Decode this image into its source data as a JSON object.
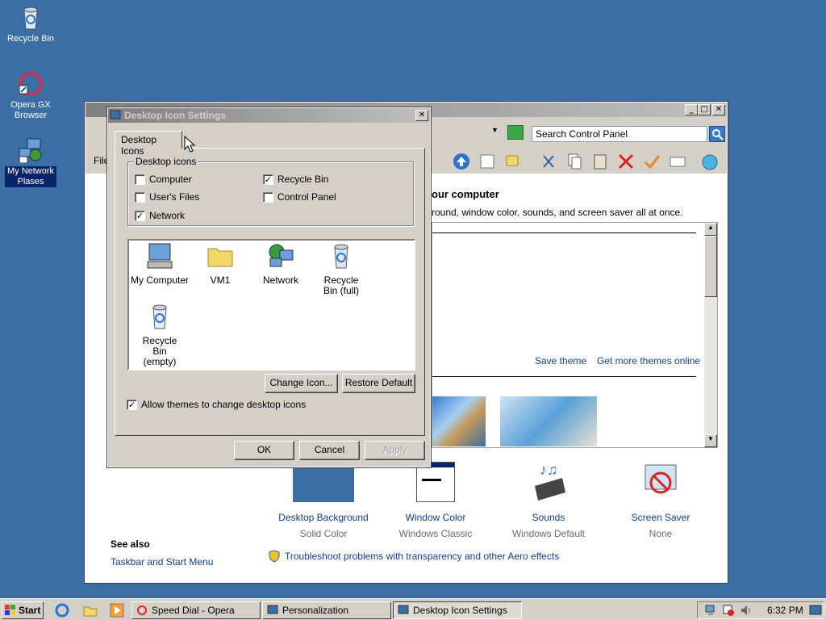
{
  "desktop": {
    "icons": [
      {
        "label": "Recycle Bin"
      },
      {
        "label": "Opera GX Browser"
      },
      {
        "label": "My Network Plases"
      }
    ]
  },
  "control_panel": {
    "search_placeholder": "Search Control Panel",
    "menu_file": "File",
    "heading": "our computer",
    "description": "round, window color, sounds, and screen saver all at once.",
    "save_theme": "Save theme",
    "get_more_themes": "Get more themes online",
    "items": [
      {
        "label": "Desktop Background",
        "value": "Solid Color"
      },
      {
        "label": "Window Color",
        "value": "Windows Classic"
      },
      {
        "label": "Sounds",
        "value": "Windows Default"
      },
      {
        "label": "Screen Saver",
        "value": "None"
      }
    ],
    "see_also": "See also",
    "taskbar_link": "Taskbar and Start Menu",
    "troubleshoot_link": "Troubleshoot problems with transparency and other Aero effects"
  },
  "dialog": {
    "title": "Desktop Icon Settings",
    "tab": "Desktop Icons",
    "group_title": "Desktop icons",
    "checkboxes": [
      {
        "label": "Computer",
        "checked": false
      },
      {
        "label": "Recycle Bin",
        "checked": true
      },
      {
        "label": "User's Files",
        "checked": false
      },
      {
        "label": "Control Panel",
        "checked": false
      },
      {
        "label": "Network",
        "checked": true
      }
    ],
    "icons": [
      {
        "label": "My Computer",
        "icon": "computer-icon"
      },
      {
        "label": "VM1",
        "icon": "folder-icon"
      },
      {
        "label": "Network",
        "icon": "network-icon"
      },
      {
        "label": "Recycle Bin (full)",
        "icon": "recycle-bin-full-icon"
      },
      {
        "label": "Recycle Bin (empty)",
        "icon": "recycle-bin-empty-icon"
      }
    ],
    "change_icon": "Change Icon...",
    "restore_default": "Restore Default",
    "allow_themes": "Allow themes to change desktop icons",
    "allow_themes_checked": true,
    "ok": "OK",
    "cancel": "Cancel",
    "apply": "Apply"
  },
  "taskbar": {
    "start": "Start",
    "tasks": [
      {
        "label": "Speed Dial - Opera"
      },
      {
        "label": "Personalization"
      },
      {
        "label": "Desktop Icon Settings"
      }
    ],
    "clock": "6:32 PM"
  },
  "colors": {
    "desktop": "#3a6ea5",
    "title_active": "#0a246a",
    "face": "#d4d0c8"
  }
}
